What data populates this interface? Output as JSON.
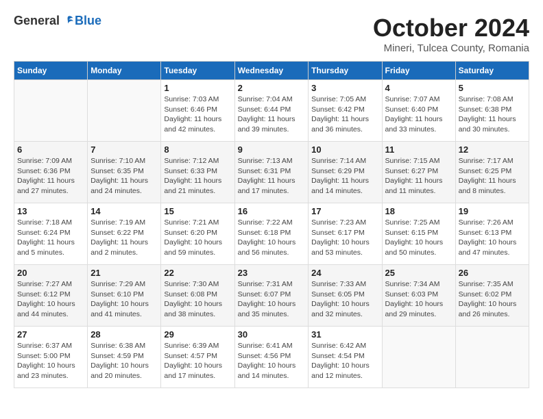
{
  "header": {
    "logo_general": "General",
    "logo_blue": "Blue",
    "month_title": "October 2024",
    "subtitle": "Mineri, Tulcea County, Romania"
  },
  "days_of_week": [
    "Sunday",
    "Monday",
    "Tuesday",
    "Wednesday",
    "Thursday",
    "Friday",
    "Saturday"
  ],
  "weeks": [
    [
      {
        "day": "",
        "info": ""
      },
      {
        "day": "",
        "info": ""
      },
      {
        "day": "1",
        "info": "Sunrise: 7:03 AM\nSunset: 6:46 PM\nDaylight: 11 hours and 42 minutes."
      },
      {
        "day": "2",
        "info": "Sunrise: 7:04 AM\nSunset: 6:44 PM\nDaylight: 11 hours and 39 minutes."
      },
      {
        "day": "3",
        "info": "Sunrise: 7:05 AM\nSunset: 6:42 PM\nDaylight: 11 hours and 36 minutes."
      },
      {
        "day": "4",
        "info": "Sunrise: 7:07 AM\nSunset: 6:40 PM\nDaylight: 11 hours and 33 minutes."
      },
      {
        "day": "5",
        "info": "Sunrise: 7:08 AM\nSunset: 6:38 PM\nDaylight: 11 hours and 30 minutes."
      }
    ],
    [
      {
        "day": "6",
        "info": "Sunrise: 7:09 AM\nSunset: 6:36 PM\nDaylight: 11 hours and 27 minutes."
      },
      {
        "day": "7",
        "info": "Sunrise: 7:10 AM\nSunset: 6:35 PM\nDaylight: 11 hours and 24 minutes."
      },
      {
        "day": "8",
        "info": "Sunrise: 7:12 AM\nSunset: 6:33 PM\nDaylight: 11 hours and 21 minutes."
      },
      {
        "day": "9",
        "info": "Sunrise: 7:13 AM\nSunset: 6:31 PM\nDaylight: 11 hours and 17 minutes."
      },
      {
        "day": "10",
        "info": "Sunrise: 7:14 AM\nSunset: 6:29 PM\nDaylight: 11 hours and 14 minutes."
      },
      {
        "day": "11",
        "info": "Sunrise: 7:15 AM\nSunset: 6:27 PM\nDaylight: 11 hours and 11 minutes."
      },
      {
        "day": "12",
        "info": "Sunrise: 7:17 AM\nSunset: 6:25 PM\nDaylight: 11 hours and 8 minutes."
      }
    ],
    [
      {
        "day": "13",
        "info": "Sunrise: 7:18 AM\nSunset: 6:24 PM\nDaylight: 11 hours and 5 minutes."
      },
      {
        "day": "14",
        "info": "Sunrise: 7:19 AM\nSunset: 6:22 PM\nDaylight: 11 hours and 2 minutes."
      },
      {
        "day": "15",
        "info": "Sunrise: 7:21 AM\nSunset: 6:20 PM\nDaylight: 10 hours and 59 minutes."
      },
      {
        "day": "16",
        "info": "Sunrise: 7:22 AM\nSunset: 6:18 PM\nDaylight: 10 hours and 56 minutes."
      },
      {
        "day": "17",
        "info": "Sunrise: 7:23 AM\nSunset: 6:17 PM\nDaylight: 10 hours and 53 minutes."
      },
      {
        "day": "18",
        "info": "Sunrise: 7:25 AM\nSunset: 6:15 PM\nDaylight: 10 hours and 50 minutes."
      },
      {
        "day": "19",
        "info": "Sunrise: 7:26 AM\nSunset: 6:13 PM\nDaylight: 10 hours and 47 minutes."
      }
    ],
    [
      {
        "day": "20",
        "info": "Sunrise: 7:27 AM\nSunset: 6:12 PM\nDaylight: 10 hours and 44 minutes."
      },
      {
        "day": "21",
        "info": "Sunrise: 7:29 AM\nSunset: 6:10 PM\nDaylight: 10 hours and 41 minutes."
      },
      {
        "day": "22",
        "info": "Sunrise: 7:30 AM\nSunset: 6:08 PM\nDaylight: 10 hours and 38 minutes."
      },
      {
        "day": "23",
        "info": "Sunrise: 7:31 AM\nSunset: 6:07 PM\nDaylight: 10 hours and 35 minutes."
      },
      {
        "day": "24",
        "info": "Sunrise: 7:33 AM\nSunset: 6:05 PM\nDaylight: 10 hours and 32 minutes."
      },
      {
        "day": "25",
        "info": "Sunrise: 7:34 AM\nSunset: 6:03 PM\nDaylight: 10 hours and 29 minutes."
      },
      {
        "day": "26",
        "info": "Sunrise: 7:35 AM\nSunset: 6:02 PM\nDaylight: 10 hours and 26 minutes."
      }
    ],
    [
      {
        "day": "27",
        "info": "Sunrise: 6:37 AM\nSunset: 5:00 PM\nDaylight: 10 hours and 23 minutes."
      },
      {
        "day": "28",
        "info": "Sunrise: 6:38 AM\nSunset: 4:59 PM\nDaylight: 10 hours and 20 minutes."
      },
      {
        "day": "29",
        "info": "Sunrise: 6:39 AM\nSunset: 4:57 PM\nDaylight: 10 hours and 17 minutes."
      },
      {
        "day": "30",
        "info": "Sunrise: 6:41 AM\nSunset: 4:56 PM\nDaylight: 10 hours and 14 minutes."
      },
      {
        "day": "31",
        "info": "Sunrise: 6:42 AM\nSunset: 4:54 PM\nDaylight: 10 hours and 12 minutes."
      },
      {
        "day": "",
        "info": ""
      },
      {
        "day": "",
        "info": ""
      }
    ]
  ]
}
